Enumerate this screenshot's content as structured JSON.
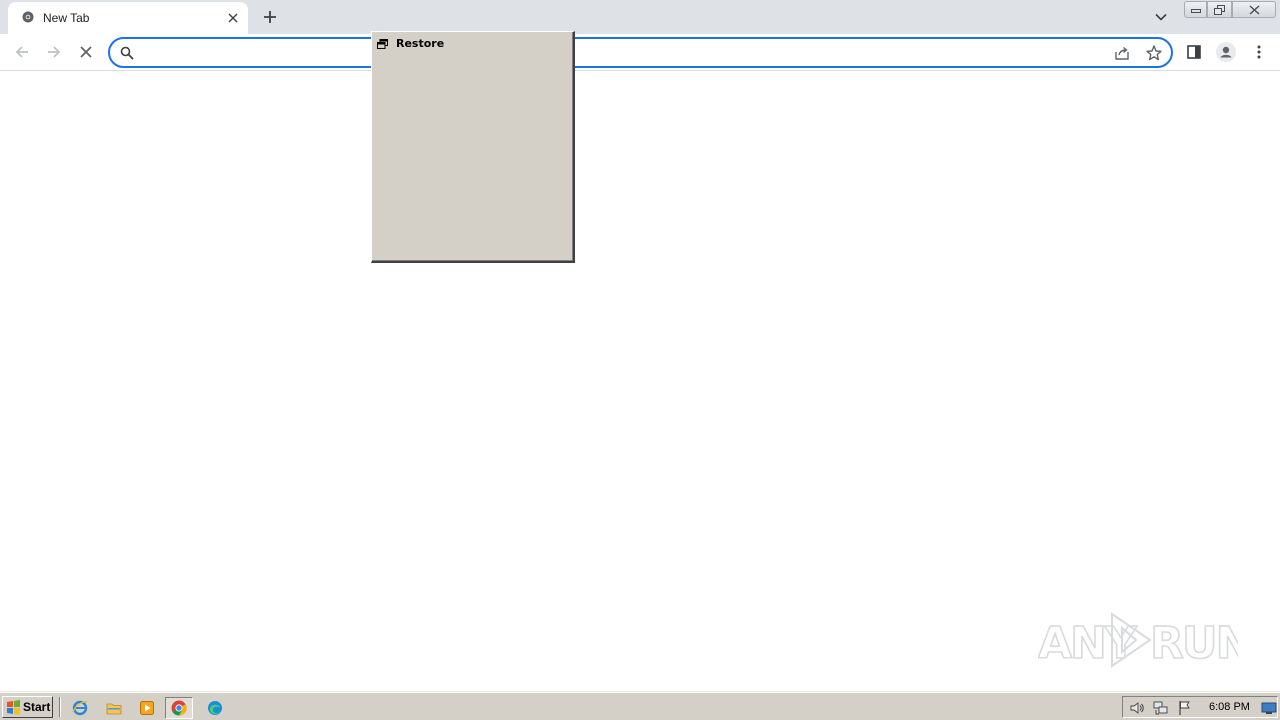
{
  "browser": {
    "tab": {
      "title": "New Tab"
    },
    "omnibox": {
      "value": "",
      "placeholder": ""
    }
  },
  "system_menu": {
    "items": [
      {
        "label": "Restore",
        "icon": "restore-window-icon"
      }
    ]
  },
  "watermark": {
    "text": "ANY RUN"
  },
  "taskbar": {
    "start_label": "Start",
    "quick_launch": [
      "internet-explorer-icon",
      "file-explorer-icon",
      "media-player-icon",
      "chrome-icon",
      "edge-icon"
    ],
    "tray_icons": [
      "volume-icon",
      "network-icon",
      "action-center-flag-icon",
      "show-desktop-icon"
    ],
    "clock": "6:08 PM"
  },
  "colors": {
    "accent": "#1a73e8",
    "tabstrip": "#dee1e6",
    "classic_face": "#d4d0c8"
  }
}
